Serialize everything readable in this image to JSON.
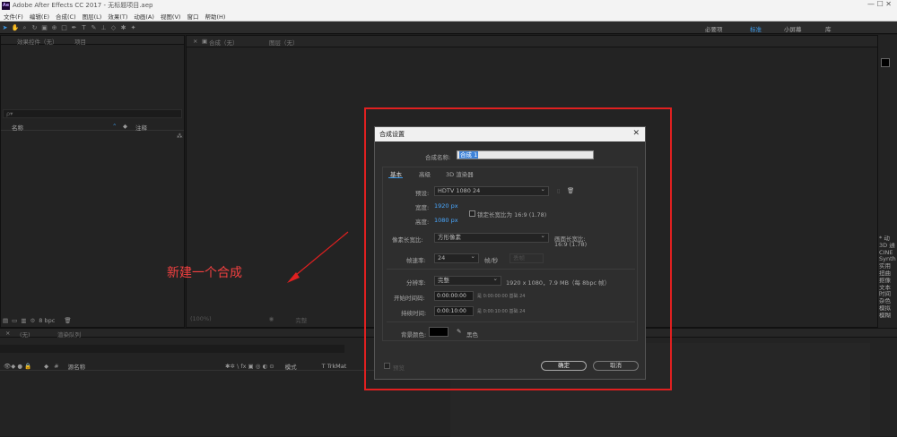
{
  "window": {
    "app_icon": "Ae",
    "title": "Adobe After Effects CC 2017 - 无标题项目.aep"
  },
  "menu": [
    "文件(F)",
    "编辑(E)",
    "合成(C)",
    "图层(L)",
    "效果(T)",
    "动画(A)",
    "视图(V)",
    "窗口",
    "帮助(H)"
  ],
  "workspaces": {
    "essentials": "必要项",
    "standard": "标准",
    "small": "小屏幕",
    "library": "库"
  },
  "project": {
    "tab": "项目",
    "effects_tab": "效果控件（无）",
    "search_placeholder": "ρ▾",
    "col_name": "名称",
    "col_note": "注释",
    "bpc": "8 bpc"
  },
  "comp": {
    "tab": "合成（无）",
    "layer_tab": "图层（无）",
    "zoom": "(100%)",
    "quality": "完整"
  },
  "timeline": {
    "tab": "(无)",
    "render_tab": "渲染队列",
    "col_source": "源名称",
    "col_mode": "模式",
    "col_trkmat": "T TrkMat"
  },
  "dialog": {
    "title": "合成设置",
    "name_label": "合成名称:",
    "name_value": "合成 1",
    "tabs": [
      "基本",
      "高级",
      "3D 渲染器"
    ],
    "preset_label": "预设:",
    "preset_value": "HDTV 1080 24",
    "width_label": "宽度:",
    "width_value": "1920 px",
    "height_label": "高度:",
    "height_value": "1080 px",
    "lock_label": "锁定长宽比为 16:9 (1.78)",
    "par_label": "像素长宽比:",
    "par_value": "方形像素",
    "frame_aspect_label": "画面长宽比:",
    "frame_aspect_value": "16:9 (1.78)",
    "fps_label": "帧速率:",
    "fps_value": "24",
    "fps_unit": "帧/秒",
    "fps_drop": "丢帧",
    "res_label": "分辨率:",
    "res_value": "完整",
    "res_info": "1920 x 1080，7.9 MB（每 8bpc 帧）",
    "start_label": "开始时间码:",
    "start_value": "0:00:00:00",
    "start_info": "是 0:00:00:00  基础 24",
    "dur_label": "持续时间:",
    "dur_value": "0:00:10:00",
    "dur_info": "是 0:00:10:00  基础 24",
    "bg_label": "背景颜色:",
    "bg_name": "黑色",
    "preview_label": "预览",
    "ok": "确定",
    "cancel": "取消"
  },
  "annotation": "新建一个合成",
  "right_panel": [
    "* 动",
    "3D 通",
    "CINE",
    "Synth",
    "实用",
    "扭曲",
    "抠像",
    "文本",
    "时间",
    "杂色",
    "模拟",
    "模糊"
  ],
  "colors": {
    "accent": "#3d9ae8",
    "annotation": "#e02020",
    "dialog_bg": "#2e2e2e"
  }
}
